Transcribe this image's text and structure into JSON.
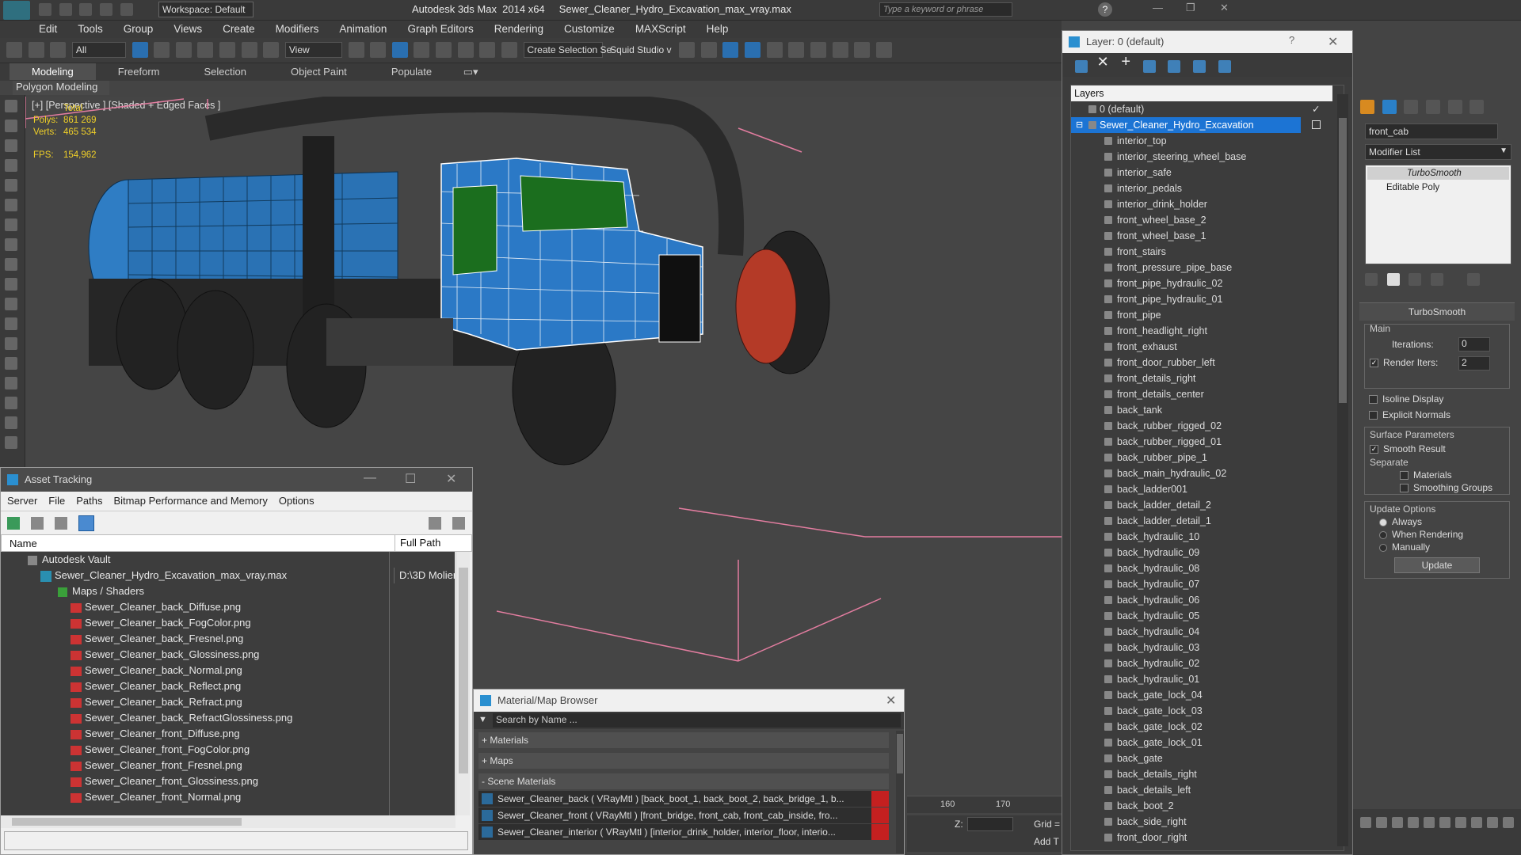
{
  "app": {
    "title": "Autodesk 3ds Max  2014 x64     Sewer_Cleaner_Hydro_Excavation_max_vray.max",
    "workspace": "Workspace: Default",
    "search_placeholder": "Type a keyword or phrase"
  },
  "menu": [
    "Edit",
    "Tools",
    "Group",
    "Views",
    "Create",
    "Modifiers",
    "Animation",
    "Graph Editors",
    "Rendering",
    "Customize",
    "MAXScript",
    "Help"
  ],
  "toolbar": {
    "filter": "All",
    "view": "View",
    "selection_set": "Create Selection Se",
    "squid": "Squid Studio v"
  },
  "ribbon": {
    "tabs": [
      "Modeling",
      "Freeform",
      "Selection",
      "Object Paint",
      "Populate"
    ],
    "sub": "Polygon Modeling"
  },
  "viewport": {
    "label": "[+] [Perspective ] [Shaded + Edged Faces ]",
    "stats": {
      "total": "Total",
      "polys_label": "Polys:",
      "polys": "861 269",
      "verts_label": "Verts:",
      "verts": "465 534",
      "fps_label": "FPS:",
      "fps": "154,962"
    }
  },
  "asset_tracking": {
    "title": "Asset Tracking",
    "menu": [
      "Server",
      "File",
      "Paths",
      "Bitmap Performance and Memory",
      "Options"
    ],
    "col_name": "Name",
    "col_path": "Full Path",
    "vault": "Autodesk Vault",
    "file": "Sewer_Cleaner_Hydro_Excavation_max_vray.max",
    "file_path": "D:\\3D Molier",
    "maps_group": "Maps / Shaders",
    "maps": [
      "Sewer_Cleaner_back_Diffuse.png",
      "Sewer_Cleaner_back_FogColor.png",
      "Sewer_Cleaner_back_Fresnel.png",
      "Sewer_Cleaner_back_Glossiness.png",
      "Sewer_Cleaner_back_Normal.png",
      "Sewer_Cleaner_back_Reflect.png",
      "Sewer_Cleaner_back_Refract.png",
      "Sewer_Cleaner_back_RefractGlossiness.png",
      "Sewer_Cleaner_front_Diffuse.png",
      "Sewer_Cleaner_front_FogColor.png",
      "Sewer_Cleaner_front_Fresnel.png",
      "Sewer_Cleaner_front_Glossiness.png",
      "Sewer_Cleaner_front_Normal.png"
    ]
  },
  "material_browser": {
    "title": "Material/Map Browser",
    "search": "Search by Name ...",
    "groups": [
      "+ Materials",
      "+ Maps",
      "- Scene Materials"
    ],
    "materials": [
      "Sewer_Cleaner_back  ( VRayMtl ) [back_boot_1, back_boot_2, back_bridge_1, b...",
      "Sewer_Cleaner_front  ( VRayMtl ) [front_bridge, front_cab, front_cab_inside, fro...",
      "Sewer_Cleaner_interior  ( VRayMtl ) [interior_drink_holder, interior_floor, interio..."
    ]
  },
  "layers": {
    "title": "Layer: 0 (default)",
    "header": "Layers",
    "default_layer": "0 (default)",
    "selected_layer": "Sewer_Cleaner_Hydro_Excavation",
    "objects": [
      "interior_top",
      "interior_steering_wheel_base",
      "interior_safe",
      "interior_pedals",
      "interior_drink_holder",
      "front_wheel_base_2",
      "front_wheel_base_1",
      "front_stairs",
      "front_pressure_pipe_base",
      "front_pipe_hydraulic_02",
      "front_pipe_hydraulic_01",
      "front_pipe",
      "front_headlight_right",
      "front_exhaust",
      "front_door_rubber_left",
      "front_details_right",
      "front_details_center",
      "back_tank",
      "back_rubber_rigged_02",
      "back_rubber_rigged_01",
      "back_rubber_pipe_1",
      "back_main_hydraulic_02",
      "back_ladder001",
      "back_ladder_detail_2",
      "back_ladder_detail_1",
      "back_hydraulic_10",
      "back_hydraulic_09",
      "back_hydraulic_08",
      "back_hydraulic_07",
      "back_hydraulic_06",
      "back_hydraulic_05",
      "back_hydraulic_04",
      "back_hydraulic_03",
      "back_hydraulic_02",
      "back_hydraulic_01",
      "back_gate_lock_04",
      "back_gate_lock_03",
      "back_gate_lock_02",
      "back_gate_lock_01",
      "back_gate",
      "back_details_right",
      "back_details_left",
      "back_boot_2",
      "back_side_right",
      "front_door_right"
    ]
  },
  "command_panel": {
    "object_name": "front_cab",
    "modifier_list": "Modifier List",
    "stack": [
      "TurboSmooth",
      "Editable Poly"
    ],
    "rollout": "TurboSmooth",
    "main": "Main",
    "iterations_label": "Iterations:",
    "iterations": "0",
    "render_iters_label": "Render Iters:",
    "render_iters": "2",
    "isoline": "Isoline Display",
    "explicit": "Explicit Normals",
    "surface": "Surface Parameters",
    "smooth_result": "Smooth Result",
    "separate": "Separate",
    "materials": "Materials",
    "smoothing_groups": "Smoothing Groups",
    "update_options": "Update Options",
    "always": "Always",
    "when_rendering": "When Rendering",
    "manually": "Manually",
    "update": "Update"
  },
  "timeline": {
    "ticks": [
      "160",
      "170"
    ],
    "z_label": "Z:",
    "grid": "Grid =",
    "addt": "Add T"
  }
}
